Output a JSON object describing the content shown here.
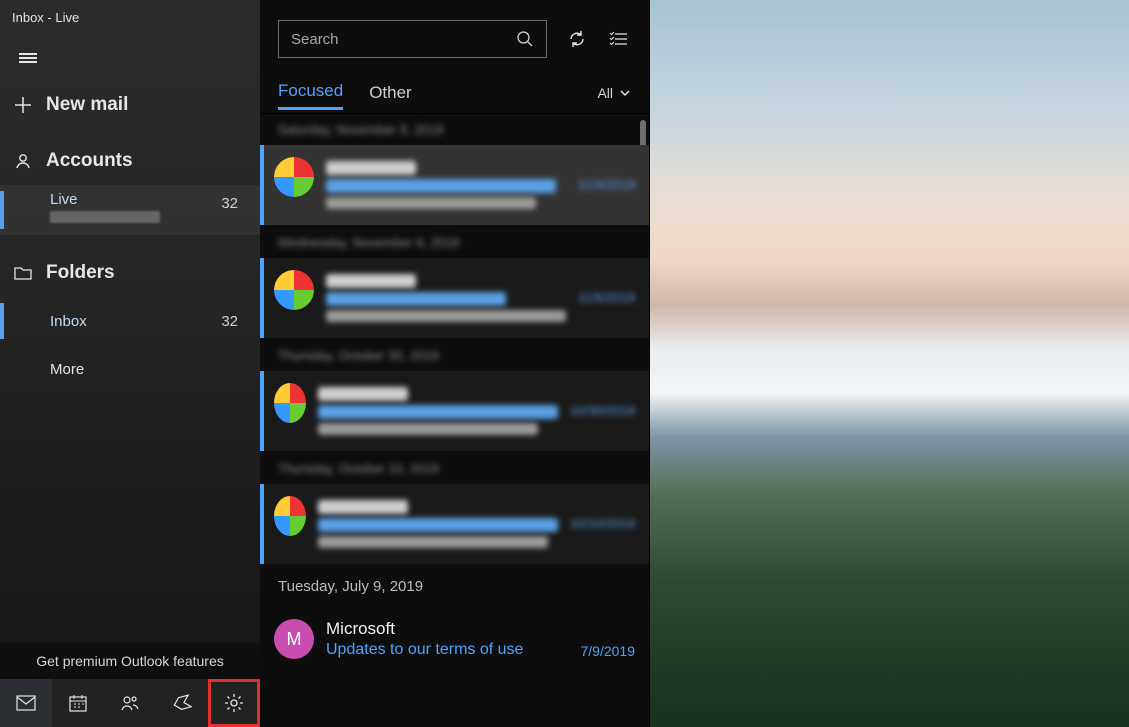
{
  "window": {
    "title": "Inbox - Live"
  },
  "sidebar": {
    "newMail": "New mail",
    "accounts": "Accounts",
    "accountItems": [
      {
        "name": "Live",
        "count": "32"
      }
    ],
    "folders": "Folders",
    "folderItems": [
      {
        "name": "Inbox",
        "count": "32",
        "active": true
      },
      {
        "name": "More",
        "count": ""
      }
    ],
    "premium": "Get premium Outlook features"
  },
  "list": {
    "searchPlaceholder": "Search",
    "tabs": {
      "focused": "Focused",
      "other": "Other"
    },
    "filter": "All",
    "dateHeader": "Tuesday, July 9, 2019",
    "sample": {
      "sender": "Microsoft",
      "subject": "Updates to our terms of use",
      "date": "7/9/2019",
      "avatarLetter": "M"
    }
  }
}
